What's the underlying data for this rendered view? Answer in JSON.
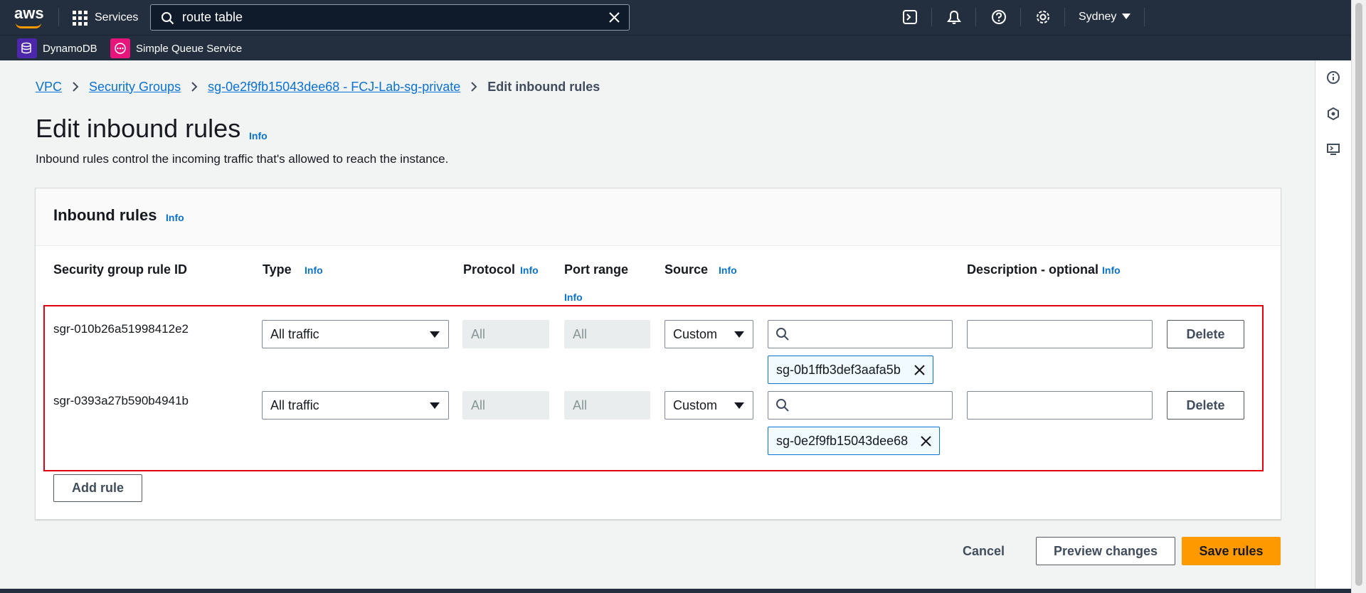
{
  "topnav": {
    "logo_text": "aws",
    "services_label": "Services",
    "search_value": "route table",
    "region": "Sydney",
    "icons": [
      "grid-icon",
      "search-icon",
      "close-icon",
      "cloudshell-icon",
      "bell-icon",
      "help-icon",
      "gear-icon",
      "caret-down-icon"
    ]
  },
  "favorites": [
    {
      "label": "DynamoDB",
      "color": "#4d27aa"
    },
    {
      "label": "Simple Queue Service",
      "color": "#e7157b"
    }
  ],
  "breadcrumb": {
    "items": [
      "VPC",
      "Security Groups",
      "sg-0e2f9fb15043dee68 - FCJ-Lab-sg-private"
    ],
    "current": "Edit inbound rules"
  },
  "page": {
    "title": "Edit inbound rules",
    "info": "Info",
    "description": "Inbound rules control the incoming traffic that's allowed to reach the instance."
  },
  "panel": {
    "title": "Inbound rules",
    "info": "Info",
    "columns": {
      "rule_id": "Security group rule ID",
      "type": "Type",
      "protocol": "Protocol",
      "port_range": "Port range",
      "source": "Source",
      "description": "Description - optional",
      "info": "Info"
    },
    "rules": [
      {
        "id": "sgr-010b26a51998412e2",
        "type": "All traffic",
        "protocol": "All",
        "port_range": "All",
        "source": "Custom",
        "source_search": "",
        "token": "sg-0b1ffb3def3aafa5b",
        "description": "",
        "delete": "Delete"
      },
      {
        "id": "sgr-0393a27b590b4941b",
        "type": "All traffic",
        "protocol": "All",
        "port_range": "All",
        "source": "Custom",
        "source_search": "",
        "token": "sg-0e2f9fb15043dee68",
        "description": "",
        "delete": "Delete"
      }
    ],
    "add_rule": "Add rule"
  },
  "actions": {
    "cancel": "Cancel",
    "preview": "Preview changes",
    "save": "Save rules"
  },
  "colors": {
    "nav_bg": "#232f3e",
    "link": "#0972d3",
    "primary": "#ff9900",
    "highlight": "#e3000f"
  }
}
